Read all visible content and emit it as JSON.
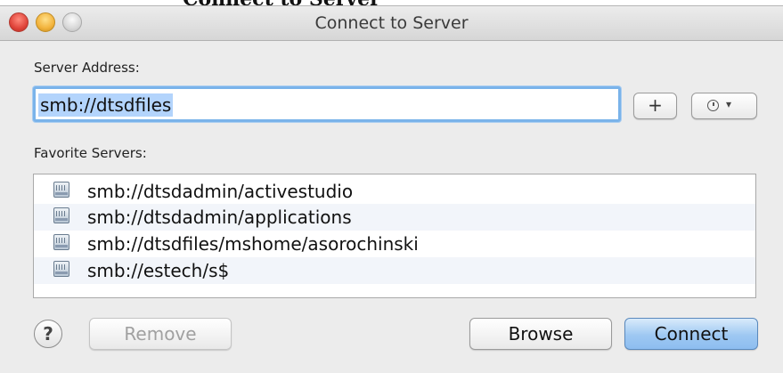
{
  "window": {
    "title": "Connect to Server"
  },
  "address": {
    "label": "Server Address:",
    "value": "smb://dtsdfiles",
    "add_label": "+",
    "history_chevron": "▾"
  },
  "favorites": {
    "label": "Favorite Servers:",
    "items": [
      {
        "label": "smb://dtsdadmin/activestudio"
      },
      {
        "label": "smb://dtsdadmin/applications"
      },
      {
        "label": "smb://dtsdfiles/mshome/asorochinski"
      },
      {
        "label": "smb://estech/s$"
      }
    ]
  },
  "buttons": {
    "help_label": "?",
    "remove_label": "Remove",
    "browse_label": "Browse",
    "connect_label": "Connect"
  },
  "icons": {
    "server": "network-server-icon",
    "history": "clock-icon"
  },
  "colors": {
    "focus_ring": "#7ab3ea",
    "selection": "#b3d4fc",
    "default_button": "#9ec8f2"
  }
}
